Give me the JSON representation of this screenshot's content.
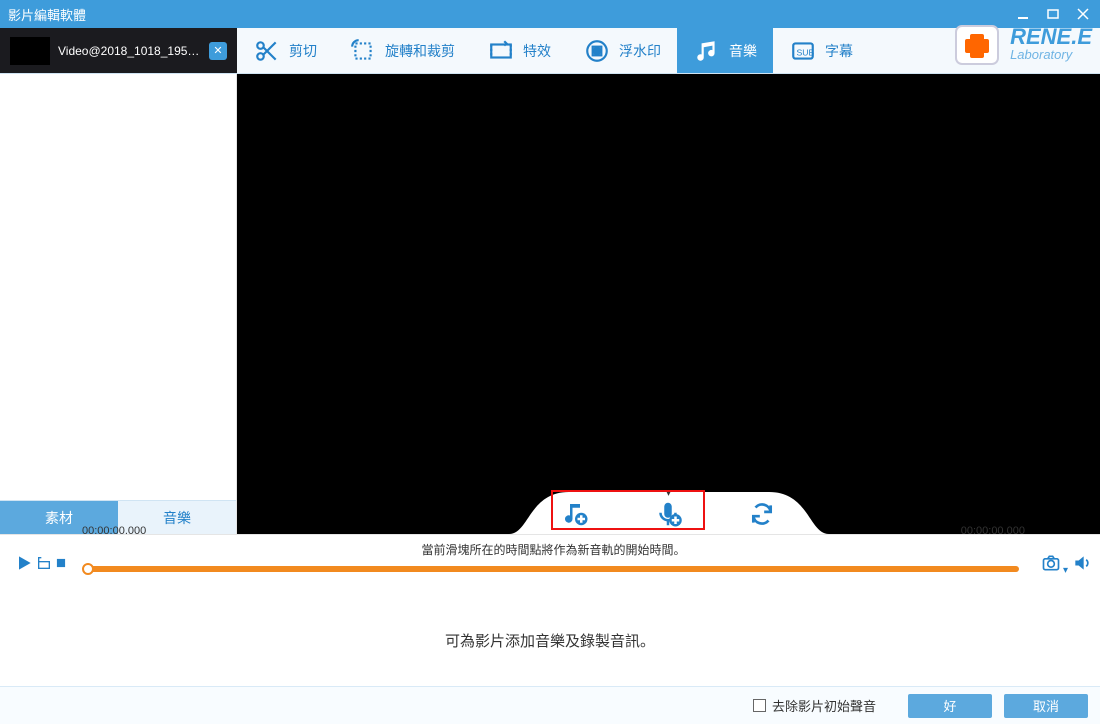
{
  "window": {
    "title": "影片編輯軟體"
  },
  "file_tab": {
    "name": "Video@2018_1018_1956..."
  },
  "toolbar": {
    "cut": "剪切",
    "rotate": "旋轉和裁剪",
    "effects": "特效",
    "watermark": "浮水印",
    "music": "音樂",
    "subtitle": "字幕"
  },
  "brand": {
    "name": "RENE.E",
    "sub": "Laboratory"
  },
  "side_tabs": {
    "materials": "素材",
    "music": "音樂"
  },
  "panel_hint": "當前滑塊所在的時間點將作為新音軌的開始時間。",
  "timeline": {
    "start": "00:00:00.000",
    "end": "00:00:00.000"
  },
  "message": "可為影片添加音樂及錄製音訊。",
  "footer": {
    "remove_audio": "去除影片初始聲音",
    "ok": "好",
    "cancel": "取消"
  },
  "colors": {
    "accent": "#3e9cdb",
    "orange": "#f28a1f"
  }
}
